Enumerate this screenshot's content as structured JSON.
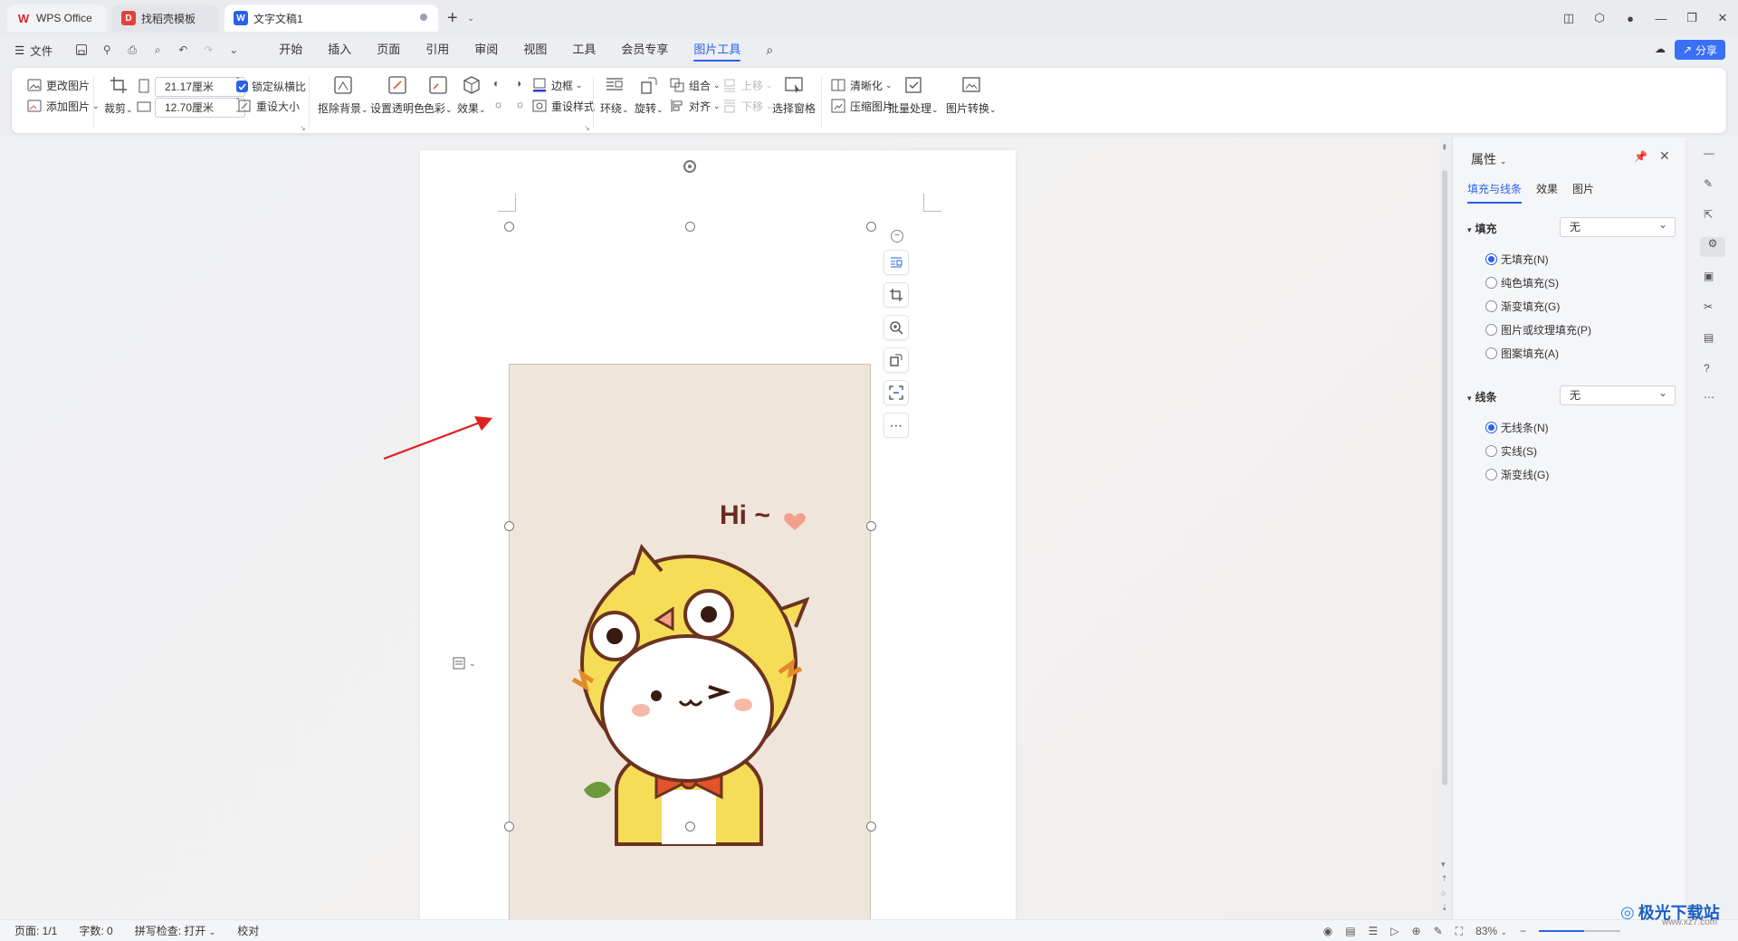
{
  "titlebar": {
    "tabs": [
      {
        "label": "WPS Office"
      },
      {
        "label": "找稻壳模板"
      },
      {
        "label": "文字文稿1"
      }
    ]
  },
  "menubar": {
    "file_label": "文件",
    "items": [
      "开始",
      "插入",
      "页面",
      "引用",
      "审阅",
      "视图",
      "工具",
      "会员专享",
      "图片工具"
    ],
    "active": "图片工具",
    "share_label": "分享"
  },
  "ribbon": {
    "change_picture": "更改图片",
    "add_picture": "添加图片",
    "crop": "裁剪",
    "width_value": "21.17厘米",
    "height_value": "12.70厘米",
    "lock_ratio": "锁定纵横比",
    "reset_size": "重设大小",
    "remove_bg": "抠除背景",
    "set_transparent": "设置透明色",
    "color": "色彩",
    "effects": "效果",
    "border": "边框",
    "reset_style": "重设样式",
    "wrap": "环绕",
    "rotate": "旋转",
    "group": "组合",
    "align": "对齐",
    "bring_forward": "上移",
    "send_backward": "下移",
    "selection_pane": "选择窗格",
    "sharpen": "清晰化",
    "compress": "压缩图片",
    "batch": "批量处理",
    "convert": "图片转换"
  },
  "picture": {
    "greeting": "Hi ~"
  },
  "panel": {
    "title": "属性",
    "tabs": [
      "填充与线条",
      "效果",
      "图片"
    ],
    "fill": {
      "label": "填充",
      "value": "无",
      "options": [
        "无填充(N)",
        "纯色填充(S)",
        "渐变填充(G)",
        "图片或纹理填充(P)",
        "图案填充(A)"
      ],
      "selected": 0
    },
    "line": {
      "label": "线条",
      "value": "无",
      "options": [
        "无线条(N)",
        "实线(S)",
        "渐变线(G)"
      ],
      "selected": 0
    }
  },
  "statusbar": {
    "page": "页面: 1/1",
    "words": "字数: 0",
    "spell": "拼写检查: 打开",
    "proof": "校对",
    "zoom": "83%"
  },
  "watermark": {
    "text": "极光下载站",
    "sub": "www.xz7.com"
  }
}
